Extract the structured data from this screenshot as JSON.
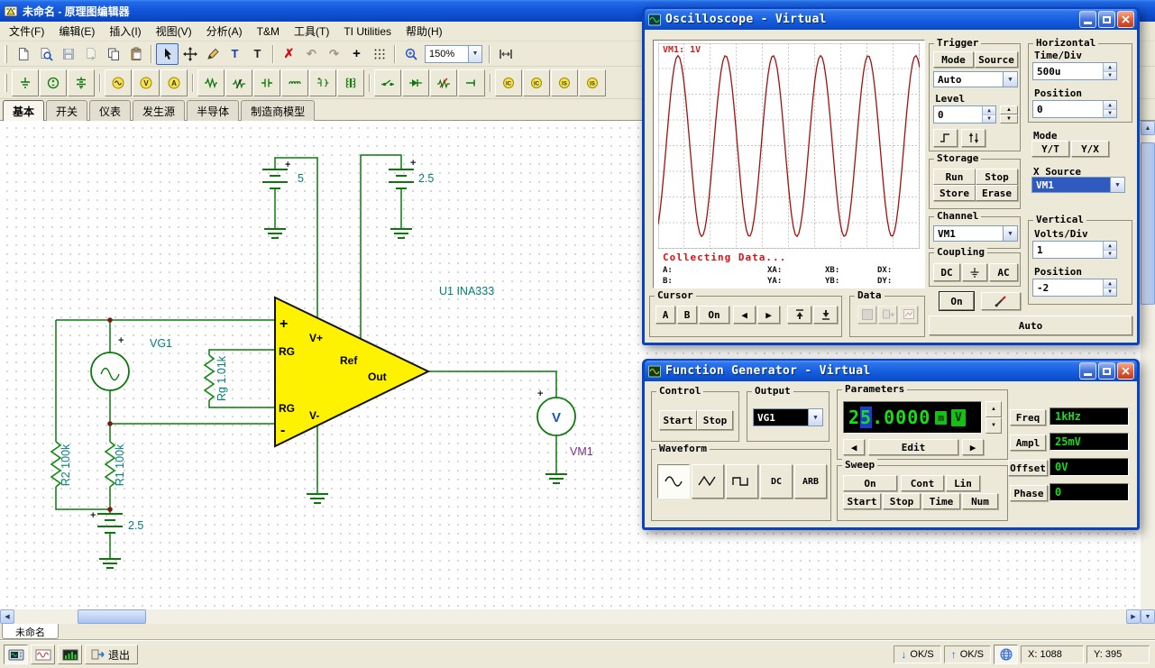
{
  "main_window": {
    "title": "未命名 - 原理图编辑器",
    "menus": [
      {
        "label": "文件(F)"
      },
      {
        "label": "编辑(E)"
      },
      {
        "label": "插入(I)"
      },
      {
        "label": "视图(V)"
      },
      {
        "label": "分析(A)"
      },
      {
        "label": "T&M"
      },
      {
        "label": "工具(T)"
      },
      {
        "label": "TI Utilities"
      },
      {
        "label": "帮助(H)"
      }
    ],
    "component_tabs": [
      {
        "label": "基本"
      },
      {
        "label": "开关"
      },
      {
        "label": "仪表"
      },
      {
        "label": "发生源"
      },
      {
        "label": "半导体"
      },
      {
        "label": "制造商模型"
      }
    ],
    "sheet_tab": "未命名"
  },
  "toolbar": {
    "zoom_value": "150%",
    "text_tool_glyph": "T",
    "label_tool_glyph": "T",
    "delete_glyph": "✗",
    "undo_glyph": "↶",
    "redo_glyph": "↷",
    "crosshair_glyph": "+"
  },
  "component_toolbar": {
    "voltmeter_letter": "V",
    "ammeter_letter": "A",
    "ic1_label": "IC",
    "ic2_label": "IC",
    "is1_label": "IS",
    "is2_label": "IS"
  },
  "schematic": {
    "power_top_left": {
      "plus": "+",
      "value": "5"
    },
    "power_top_right": {
      "plus": "+",
      "value": "2.5"
    },
    "source": {
      "name": "VG1",
      "plus": "+"
    },
    "gain_resistor": {
      "name": "Rg 1.01k"
    },
    "r2": {
      "name": "R2 100k"
    },
    "r1": {
      "name": "R1 100k"
    },
    "power_bottom": {
      "plus": "+",
      "value": "2.5"
    },
    "voltmeter": {
      "name": "VM1",
      "plus": "+",
      "letter": "V"
    },
    "opamp": {
      "ref": "U1 INA333",
      "pin_plus": "+",
      "pin_minus": "-",
      "pin_rg_top": "RG",
      "pin_rg_bottom": "RG",
      "pin_vplus": "V+",
      "pin_ref": "Ref",
      "pin_out": "Out",
      "pin_vminus": "V-"
    }
  },
  "oscilloscope": {
    "title": "Oscilloscope - Virtual",
    "channel_readout": "VM1: 1V",
    "status_text": "Collecting Data...",
    "readout_row1": {
      "a": "A:",
      "xa": "XA:",
      "xb": "XB:",
      "dx": "DX:"
    },
    "readout_row2": {
      "b": "B:",
      "ya": "YA:",
      "yb": "YB:",
      "dy": "DY:"
    },
    "cursor_group": {
      "label": "Cursor",
      "a": "A",
      "b": "B",
      "on": "On",
      "left": "◀",
      "right": "▶"
    },
    "data_group": {
      "label": "Data"
    },
    "trigger": {
      "label": "Trigger",
      "mode": "Mode",
      "source": "Source",
      "mode_value": "Auto",
      "level_label": "Level",
      "level_value": "0"
    },
    "horizontal": {
      "label": "Horizontal",
      "timediv_label": "Time/Div",
      "timediv_value": "500u",
      "position_label": "Position",
      "position_value": "0"
    },
    "mode_section": {
      "label": "Mode",
      "yt": "Y/T",
      "yx": "Y/X"
    },
    "xsource": {
      "label": "X Source",
      "value": "VM1"
    },
    "storage": {
      "label": "Storage",
      "run": "Run",
      "stop": "Stop",
      "store": "Store",
      "erase": "Erase"
    },
    "channel": {
      "label": "Channel",
      "value": "VM1"
    },
    "coupling": {
      "label": "Coupling",
      "dc": "DC",
      "ac": "AC"
    },
    "vertical": {
      "label": "Vertical",
      "voltsdiv_label": "Volts/Div",
      "voltsdiv_value": "1",
      "position_label": "Position",
      "position_value": "-2",
      "on": "On"
    },
    "auto_button": "Auto",
    "trace": {
      "type": "sine",
      "cycles_visible": 5.5,
      "amplitude_frac": 0.44,
      "phase_deg": -60,
      "color": "#a50f0f"
    }
  },
  "function_generator": {
    "title": "Function Generator - Virtual",
    "control": {
      "label": "Control",
      "start": "Start",
      "stop": "Stop"
    },
    "output": {
      "label": "Output",
      "value": "VG1"
    },
    "parameters": {
      "label": "Parameters",
      "digits_pre": "2",
      "digit_selected": "5",
      "digits_post": ".0000",
      "unit_prefix": "m",
      "unit": "V",
      "left": "◀",
      "edit": "Edit",
      "right": "▶"
    },
    "waveform": {
      "label": "Waveform",
      "dc": "DC",
      "arb": "ARB"
    },
    "sweep": {
      "label": "Sweep",
      "on": "On",
      "cont": "Cont",
      "lin": "Lin",
      "start": "Start",
      "stop": "Stop",
      "time": "Time",
      "num": "Num"
    },
    "readouts": {
      "freq_label": "Freq",
      "freq_value": "1kHz",
      "ampl_label": "Ampl",
      "ampl_value": "25mV",
      "offset_label": "Offset",
      "offset_value": "0V",
      "phase_label": "Phase",
      "phase_value": "0"
    }
  },
  "statusbar": {
    "exit_label": "退出",
    "rx_label": "OK/S",
    "tx_label": "OK/S",
    "x_coord": "X: 1088",
    "y_coord": "Y: 395"
  }
}
